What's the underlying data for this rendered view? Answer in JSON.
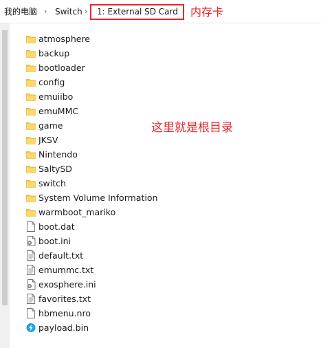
{
  "breadcrumb": {
    "items": [
      "我的电脑",
      "Switch"
    ],
    "current": "1: External SD Card"
  },
  "annotations": {
    "sd_card": "内存卡",
    "root_dir": "这里就是根目录"
  },
  "annotation_color": "#e8262d",
  "files": [
    {
      "name": "atmosphere",
      "icon": "folder-icon"
    },
    {
      "name": "backup",
      "icon": "folder-icon"
    },
    {
      "name": "bootloader",
      "icon": "folder-icon"
    },
    {
      "name": "config",
      "icon": "folder-icon"
    },
    {
      "name": "emuiibo",
      "icon": "folder-icon"
    },
    {
      "name": "emuMMC",
      "icon": "folder-icon"
    },
    {
      "name": "game",
      "icon": "folder-icon"
    },
    {
      "name": "JKSV",
      "icon": "folder-icon"
    },
    {
      "name": "Nintendo",
      "icon": "folder-icon"
    },
    {
      "name": "SaltySD",
      "icon": "folder-icon"
    },
    {
      "name": "switch",
      "icon": "folder-icon"
    },
    {
      "name": "System Volume Information",
      "icon": "folder-icon"
    },
    {
      "name": "warmboot_mariko",
      "icon": "folder-icon"
    },
    {
      "name": "boot.dat",
      "icon": "file-icon"
    },
    {
      "name": "boot.ini",
      "icon": "settings-file-icon"
    },
    {
      "name": "default.txt",
      "icon": "text-file-icon"
    },
    {
      "name": "emummc.txt",
      "icon": "text-file-icon"
    },
    {
      "name": "exosphere.ini",
      "icon": "settings-file-icon"
    },
    {
      "name": "favorites.txt",
      "icon": "text-file-icon"
    },
    {
      "name": "hbmenu.nro",
      "icon": "file-icon"
    },
    {
      "name": "payload.bin",
      "icon": "payload-bin-icon"
    }
  ]
}
